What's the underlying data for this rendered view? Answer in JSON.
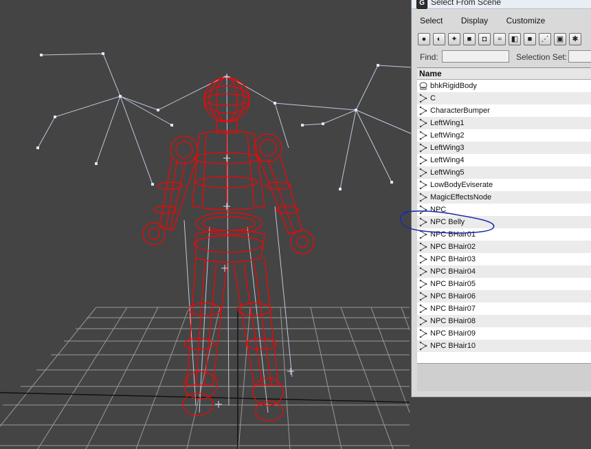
{
  "window": {
    "title": "Select From Scene",
    "icon_letter": "G"
  },
  "menu": {
    "items": [
      "Select",
      "Display",
      "Customize"
    ]
  },
  "toolbar": {
    "icons": [
      "sphere-icon",
      "teapot-icon",
      "light-icon",
      "camera-icon",
      "helper-icon",
      "spacewarp-icon",
      "group-icon",
      "xref-icon",
      "bone-icon",
      "container-icon",
      "frozen-icon"
    ]
  },
  "find": {
    "label": "Find:",
    "value": ""
  },
  "selection_set": {
    "label": "Selection Set:",
    "value": ""
  },
  "list": {
    "header": "Name",
    "rows": [
      "bhkRigidBody",
      "C",
      "CharacterBumper",
      "LeftWing1",
      "LeftWing2",
      "LeftWing3",
      "LeftWing4",
      "LeftWing5",
      "LowBodyEviserate",
      "MagicEffectsNode",
      "NPC",
      "NPC Belly",
      "NPC BHair01",
      "NPC BHair02",
      "NPC BHair03",
      "NPC BHair04",
      "NPC BHair05",
      "NPC BHair06",
      "NPC BHair07",
      "NPC BHair08",
      "NPC BHair09",
      "NPC BHair10"
    ]
  },
  "colors": {
    "viewport_bg": "#444444",
    "wireframe": "#ff0000",
    "bones": "#b8c4dd",
    "annotation": "#1a2fa8"
  }
}
